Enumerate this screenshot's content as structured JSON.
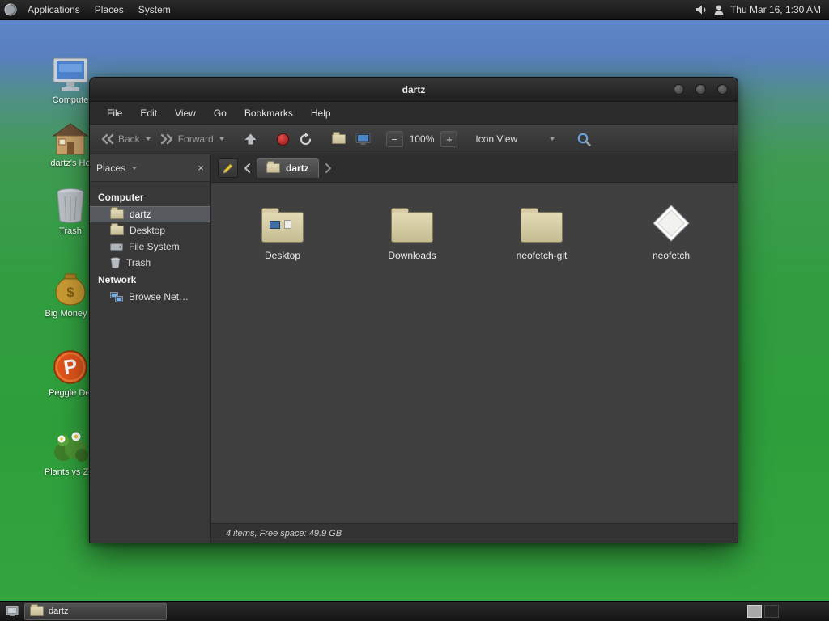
{
  "top_panel": {
    "menus": [
      {
        "label": "Applications"
      },
      {
        "label": "Places"
      },
      {
        "label": "System"
      }
    ],
    "clock": "Thu Mar 16, 1:30 AM"
  },
  "desktop": {
    "icons": [
      {
        "label": "Compute"
      },
      {
        "label": "dartz's Ho"
      },
      {
        "label": "Trash"
      },
      {
        "label": "Big Money D"
      },
      {
        "label": "Peggle Del"
      },
      {
        "label": "Plants vs Zor"
      }
    ]
  },
  "window": {
    "title": "dartz",
    "menubar": [
      {
        "label": "File"
      },
      {
        "label": "Edit"
      },
      {
        "label": "View"
      },
      {
        "label": "Go"
      },
      {
        "label": "Bookmarks"
      },
      {
        "label": "Help"
      }
    ],
    "toolbar": {
      "back": "Back",
      "forward": "Forward",
      "zoom_level": "100%",
      "view_mode": "Icon View"
    },
    "location": {
      "breadcrumb": "dartz"
    },
    "sidebar": {
      "selector": "Places",
      "computer_header": "Computer",
      "computer_items": [
        {
          "label": "dartz"
        },
        {
          "label": "Desktop"
        },
        {
          "label": "File System"
        },
        {
          "label": "Trash"
        }
      ],
      "network_header": "Network",
      "network_items": [
        {
          "label": "Browse Net…"
        }
      ]
    },
    "files": [
      {
        "name": "Desktop"
      },
      {
        "name": "Downloads"
      },
      {
        "name": "neofetch-git"
      },
      {
        "name": "neofetch"
      }
    ],
    "status": "4 items, Free space: 49.9 GB"
  },
  "bottom_panel": {
    "task_label": "dartz"
  },
  "icons": {
    "close": "×",
    "zoom_out": "−",
    "zoom_in": "+"
  },
  "colors": {
    "selection": "#565a5e",
    "folder": "#d8cfa6",
    "search_accent": "#6aa0dc"
  }
}
